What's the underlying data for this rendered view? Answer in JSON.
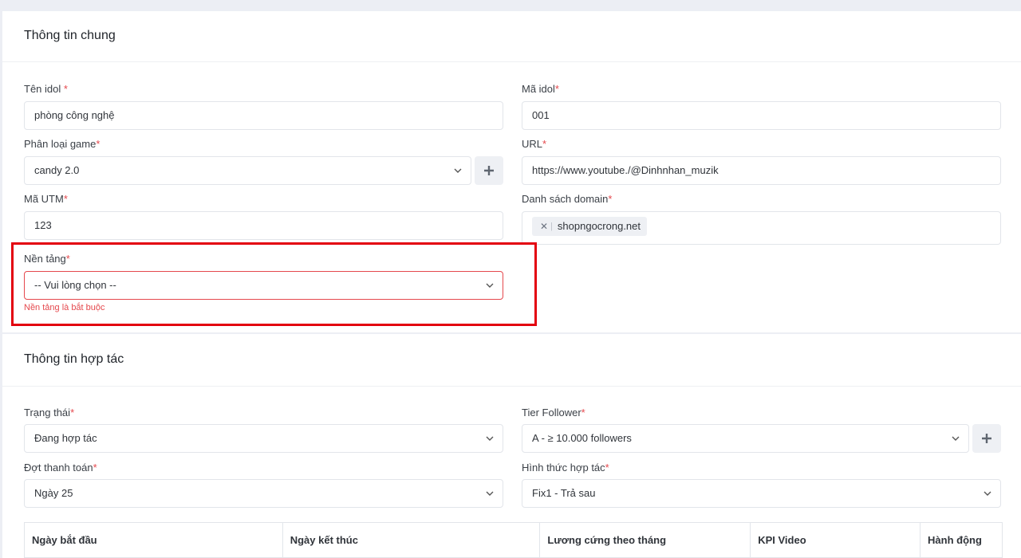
{
  "general": {
    "title": "Thông tin chung",
    "idol_name": {
      "label": "Tên idol",
      "required": "*",
      "value": "phòng công nghệ"
    },
    "idol_code": {
      "label": "Mã idol",
      "required": "*",
      "value": "001"
    },
    "game_type": {
      "label": "Phân loại game",
      "required": "*",
      "value": "candy 2.0"
    },
    "url": {
      "label": "URL",
      "required": "*",
      "value": "https://www.youtube./@Dinhnhan_muzik"
    },
    "utm_code": {
      "label": "Mã UTM",
      "required": "*",
      "value": "123"
    },
    "domains": {
      "label": "Danh sách domain",
      "required": "*",
      "tags": [
        "shopngocrong.net"
      ],
      "remove_glyph": "✕",
      "separator": "|"
    },
    "platform": {
      "label": "Nền tảng",
      "required": "*",
      "placeholder": "-- Vui lòng chọn --",
      "error": "Nền tảng là bắt buộc"
    }
  },
  "cooperation": {
    "title": "Thông tin hợp tác",
    "status": {
      "label": "Trạng thái",
      "required": "*",
      "value": "Đang hợp tác"
    },
    "tier": {
      "label": "Tier Follower",
      "required": "*",
      "value": "A - ≥ 10.000 followers"
    },
    "payment": {
      "label": "Đợt thanh toán",
      "required": "*",
      "value": "Ngày 25"
    },
    "form": {
      "label": "Hình thức hợp tác",
      "required": "*",
      "value": "Fix1 - Trả sau"
    },
    "table_headers": [
      "Ngày bắt đầu",
      "Ngày kết thúc",
      "Lương cứng theo tháng",
      "KPI Video",
      "Hành động"
    ]
  },
  "colors": {
    "error": "#e5484d",
    "highlight": "#e3000f",
    "page_bg": "#eceef4"
  }
}
